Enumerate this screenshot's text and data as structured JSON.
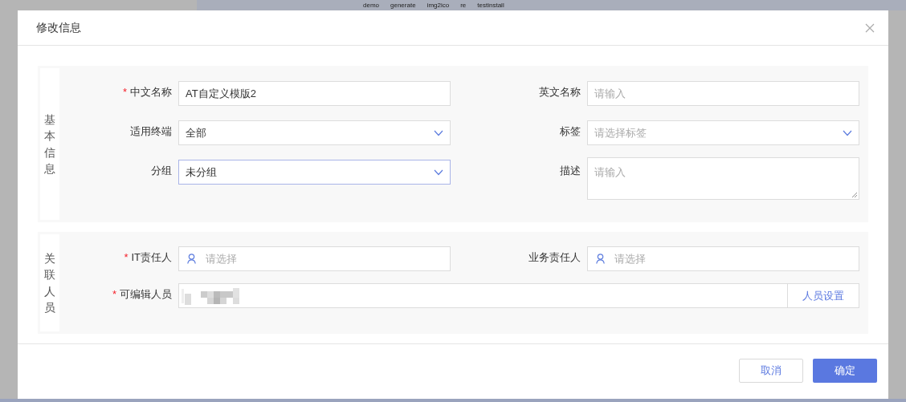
{
  "background": {
    "labels": [
      "demo",
      "generate",
      "img2ico",
      "re",
      "testinstall"
    ]
  },
  "dialog": {
    "title": "修改信息",
    "sections": [
      {
        "title": "基本信息",
        "fields": [
          {
            "label": "中文名称",
            "required_mark": "*",
            "kind": "text",
            "value": "AT自定义模版2"
          },
          {
            "label": "英文名称",
            "kind": "text",
            "placeholder": "请输入"
          },
          {
            "label": "适用终端",
            "kind": "select",
            "value": "全部",
            "focused": false
          },
          {
            "label": "标签",
            "kind": "select",
            "placeholder": "请选择标签",
            "focused": false
          },
          {
            "label": "分组",
            "kind": "select",
            "value": "未分组",
            "focused": true
          },
          {
            "label": "描述",
            "kind": "textarea",
            "placeholder": "请输入"
          }
        ]
      },
      {
        "title": "关联人员",
        "fields": [
          {
            "label": "IT责任人",
            "required_mark": "*",
            "kind": "person",
            "placeholder": "请选择"
          },
          {
            "label": "业务责任人",
            "kind": "person",
            "placeholder": "请选择"
          },
          {
            "label": "可编辑人员",
            "required_mark": "*",
            "kind": "people",
            "redacted": true,
            "button": "人员设置"
          }
        ]
      }
    ],
    "buttons": [
      {
        "label": "取消",
        "primary": false
      },
      {
        "label": "确定",
        "primary": true
      }
    ]
  }
}
